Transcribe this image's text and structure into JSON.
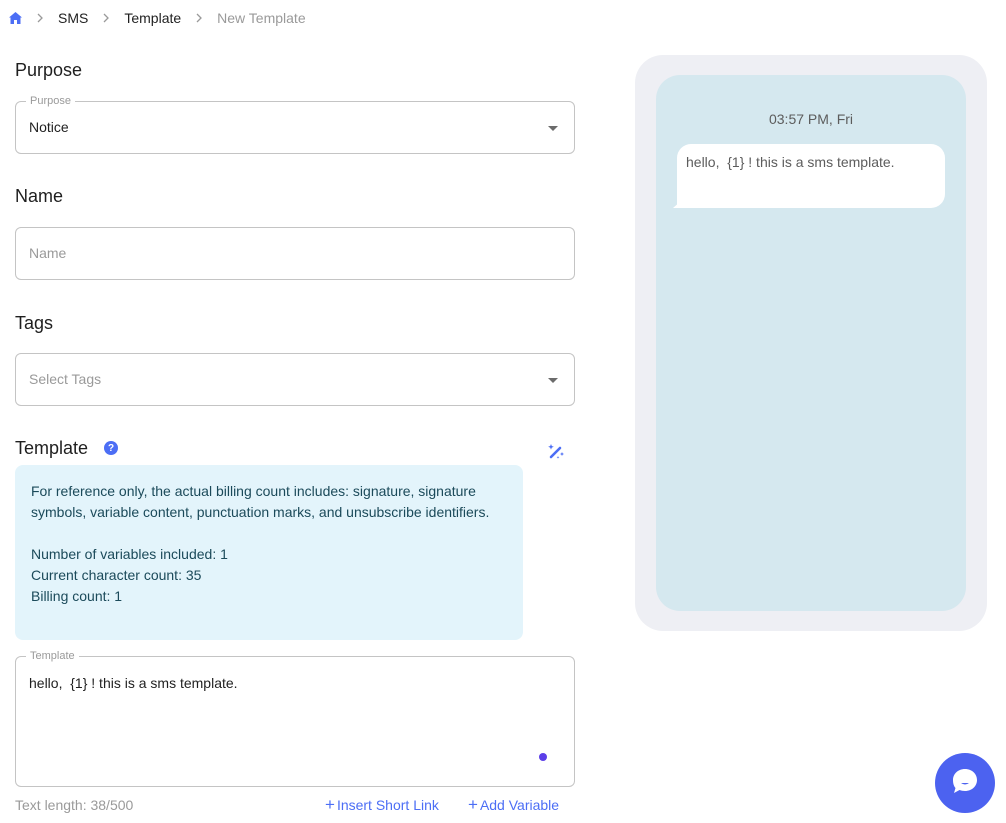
{
  "breadcrumb": {
    "home_icon": "home-icon",
    "separator_icon": "chevron-right-icon",
    "items": [
      "SMS",
      "Template",
      "New Template"
    ]
  },
  "form": {
    "purpose": {
      "section_title": "Purpose",
      "legend": "Purpose",
      "value": "Notice"
    },
    "name": {
      "section_title": "Name",
      "placeholder": "Name",
      "value": ""
    },
    "tags": {
      "section_title": "Tags",
      "placeholder": "Select Tags"
    },
    "template": {
      "section_title": "Template",
      "help_icon": "question-circle-icon",
      "ai_icon": "magic-wand-icon",
      "info": {
        "note": "For reference only, the actual billing count includes: signature, signature symbols, variable content, punctuation marks, and unsubscribe identifiers.",
        "variables": "Number of variables included: 1",
        "characters": "Current character count: 35",
        "billing": "Billing count: 1"
      },
      "legend": "Template",
      "value": "hello,  {1} ! this is a sms template.",
      "text_length": "Text length: 38/500",
      "insert_short_link": "Insert Short Link",
      "add_variable": "Add Variable"
    }
  },
  "preview": {
    "timestamp": "03:57 PM, Fri",
    "message": "hello,  {1} ! this is a sms template."
  },
  "colors": {
    "accent": "#4c6ef5",
    "info_bg": "#e3f4fb",
    "phone_frame": "#eeeff4",
    "phone_screen": "#d5e8ef",
    "chat_fab": "#4c62f0"
  },
  "chat_fab_icon": "chat-bubble-icon"
}
